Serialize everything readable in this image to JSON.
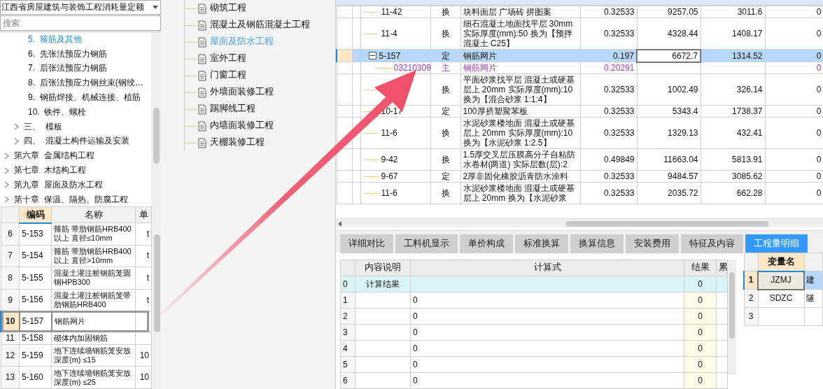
{
  "library_select": {
    "value": "江西省房屋建筑与装饰工程消耗量定额"
  },
  "search": {
    "placeholder": "搜索"
  },
  "chapter_tree": [
    {
      "kind": "leaf",
      "number": "5.",
      "label": "箍筋及其他",
      "selected": true
    },
    {
      "kind": "leaf",
      "number": "6.",
      "label": "先张法预应力钢筋",
      "selected": false
    },
    {
      "kind": "leaf",
      "number": "7.",
      "label": "后张法预应力钢筋",
      "selected": false
    },
    {
      "kind": "leaf",
      "number": "8.",
      "label": "后张法预应力钢丝束(钢绞…",
      "selected": false
    },
    {
      "kind": "leaf",
      "number": "9.",
      "label": "钢筋焊接、机械连接、植筋",
      "selected": false
    },
    {
      "kind": "leaf",
      "number": "10.",
      "label": "铁件、螺栓",
      "selected": false
    },
    {
      "kind": "section",
      "number": "三、",
      "label": "模板",
      "selected": false,
      "expanded": false
    },
    {
      "kind": "section",
      "number": "四、",
      "label": "混凝土构件运输及安装",
      "selected": false,
      "expanded": false
    },
    {
      "kind": "chapter",
      "number": "第六章",
      "label": "金属结构工程",
      "selected": false,
      "expanded": false
    },
    {
      "kind": "chapter",
      "number": "第七章",
      "label": "木结构工程",
      "selected": false,
      "expanded": false
    },
    {
      "kind": "chapter",
      "number": "第九章",
      "label": "屋面及防水工程",
      "selected": false,
      "expanded": false
    },
    {
      "kind": "chapter",
      "number": "第十章",
      "label": "保温、隔热、防腐工程",
      "selected": false,
      "expanded": false
    }
  ],
  "quota_table": {
    "columns": [
      {
        "label": "编码",
        "sorted": true
      },
      {
        "label": "名称",
        "sorted": false
      },
      {
        "label": "单",
        "sorted": false
      }
    ],
    "rows": [
      {
        "index": "6",
        "code": "5-153",
        "name": "箍筋 带肋钢筋HRB400以上 直径≤10mm",
        "unit": "t",
        "selected": false
      },
      {
        "index": "7",
        "code": "5-154",
        "name": "箍筋 带肋钢筋HRB400以上 直径>10mm",
        "unit": "t",
        "selected": false
      },
      {
        "index": "8",
        "code": "5-155",
        "name": "混凝土灌注桩钢筋笼圆钢HPB300",
        "unit": "t",
        "selected": false
      },
      {
        "index": "9",
        "code": "5-156",
        "name": "混凝土灌注桩钢筋笼带肋钢筋HRB400",
        "unit": "t",
        "selected": false
      },
      {
        "index": "10",
        "code": "5-157",
        "name": "钢筋网片",
        "selected": true
      },
      {
        "index": "11",
        "code": "5-158",
        "name": "砌体内加固钢筋",
        "selected": false
      },
      {
        "index": "12",
        "code": "5-159",
        "name": "地下连续墙钢筋笼安放深度(m) ≤15",
        "unit": "10",
        "selected": false
      },
      {
        "index": "13",
        "code": "5-160",
        "name": "地下连续墙钢筋笼安放深度(m) ≤25",
        "unit": "10",
        "selected": false
      }
    ]
  },
  "work_list": [
    {
      "label": "砌筑工程",
      "selected": false
    },
    {
      "label": "混凝土及钢筋混凝土工程",
      "selected": false
    },
    {
      "label": "屋面及防水工程",
      "selected": true
    },
    {
      "label": "室外工程",
      "selected": false
    },
    {
      "label": "门窗工程",
      "selected": false
    },
    {
      "label": "外墙面装修工程",
      "selected": false
    },
    {
      "label": "踢脚线工程",
      "selected": false
    },
    {
      "label": "内墙面装修工程",
      "selected": false
    },
    {
      "label": "天棚装修工程",
      "selected": false
    }
  ],
  "budget_table": {
    "rows": [
      {
        "kind": "item",
        "code": "11-42",
        "type": "换",
        "name": "块料面层 广场砖 拼图案",
        "quantity": "0.32533",
        "price": "9257.05",
        "total": "3011.6",
        "column_8": "0",
        "selected": false
      },
      {
        "kind": "item",
        "code": "11-4",
        "type": "换",
        "name": "细石混凝土地面找平层 30mm 实际厚度(mm):50 换为【预拌混凝土 C25】",
        "quantity": "0.32533",
        "price": "4328.44",
        "total": "1408.17",
        "column_8": "0",
        "selected": false
      },
      {
        "kind": "group",
        "code": "5-157",
        "type": "定",
        "name": "钢筋网片",
        "quantity": "0.197",
        "price": "6672.7",
        "total": "1314.52",
        "column_8": "0",
        "selected": true,
        "expanded": true
      },
      {
        "kind": "material",
        "code": "03210309",
        "type": "主",
        "name": "钢筋网片",
        "quantity": "0.20291",
        "column_8": "0",
        "selected": false
      },
      {
        "kind": "item",
        "type": "换",
        "name": "平面砂浆找平层 混凝土或硬基层上 20mm 实际厚度(mm):10 换为【混合砂浆 1:1:4】",
        "quantity": "0.32533",
        "price": "1002.49",
        "total": "326.14",
        "column_8": "0",
        "selected": false
      },
      {
        "kind": "item",
        "code": "10-17",
        "type": "定",
        "name": "100厚挤塑聚苯板",
        "quantity": "0.32533",
        "price": "5343.4",
        "total": "1738.37",
        "column_8": "0",
        "selected": false
      },
      {
        "kind": "item",
        "code": "11-6",
        "type": "换",
        "name": "水泥砂浆楼地面 混凝土或硬基层上 20mm 实际厚度(mm):10 换为【水泥砂浆 1:2.5】",
        "quantity": "0.32533",
        "price": "1329.13",
        "total": "432.41",
        "column_8": "0",
        "selected": false
      },
      {
        "kind": "item",
        "code": "9-42",
        "type": "换",
        "name": "1.5厚交叉层压膜高分子自粘防水卷材(两道) 实际层数(层):2",
        "quantity": "0.49849",
        "price": "11663.04",
        "total": "5813.91",
        "column_8": "0",
        "selected": false
      },
      {
        "kind": "item",
        "code": "9-67",
        "type": "定",
        "name": "2厚非固化橡胶沥青防水涂料",
        "quantity": "0.32533",
        "price": "9484.57",
        "total": "3085.62",
        "column_8": "0",
        "selected": false
      },
      {
        "kind": "item",
        "code": "11-6",
        "type": "换",
        "name": "水泥砂浆楼地面 混凝土或硬基层上 20mm 换为【水泥砂浆",
        "quantity": "0.32533",
        "price": "2035.72",
        "total": "662.28",
        "column_8": "0",
        "selected": false
      }
    ]
  },
  "tabs": [
    {
      "label": "详细对比",
      "selected": false
    },
    {
      "label": "工料机显示",
      "selected": false
    },
    {
      "label": "单价构成",
      "selected": false
    },
    {
      "label": "标准换算",
      "selected": false
    },
    {
      "label": "换算信息",
      "selected": false
    },
    {
      "label": "安装费用",
      "selected": false
    },
    {
      "label": "特征及内容",
      "selected": false
    },
    {
      "label": "工程量明细",
      "selected": true
    }
  ],
  "calc_table": {
    "columns": [
      "内容说明",
      "计算式",
      "结果",
      "累"
    ],
    "rows": [
      {
        "kind": "total",
        "index": "0",
        "description": "计算结果",
        "result": "0"
      },
      {
        "kind": "line",
        "index": "1",
        "formula": "0",
        "result": "0"
      },
      {
        "kind": "line",
        "index": "2",
        "formula": "0",
        "result": "0"
      },
      {
        "kind": "line",
        "index": "3",
        "formula": "0",
        "result": "0"
      },
      {
        "kind": "line",
        "index": "4",
        "formula": "0",
        "result": "0"
      },
      {
        "kind": "line",
        "index": "5",
        "formula": "0",
        "result": "0"
      },
      {
        "kind": "line",
        "index": "6",
        "formula": "0",
        "result": "0"
      }
    ]
  },
  "variable_table": {
    "columns": [
      "变量名"
    ],
    "rows": [
      {
        "index": "1",
        "name": "JZMJ",
        "column_2": "建",
        "selected": true
      },
      {
        "index": "2",
        "name": "SDZC",
        "column_2": "隧",
        "selected": false
      },
      {
        "index": "3",
        "selected": false
      }
    ]
  }
}
